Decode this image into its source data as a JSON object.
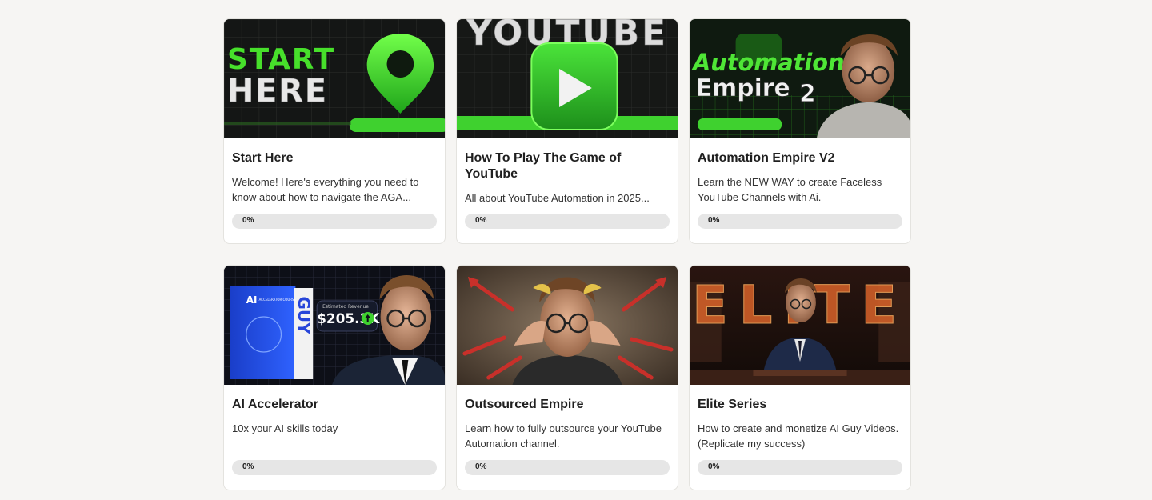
{
  "courses": [
    {
      "title": "Start Here",
      "description": "Welcome! Here's everything you need to know about how to navigate the AGA...",
      "progress_label": "0%",
      "progress": 0,
      "thumb": {
        "line1": "START",
        "line2": "HERE",
        "icon": "map-pin-icon"
      }
    },
    {
      "title": "How To Play The Game of YouTube",
      "description": "All about YouTube Automation in 2025...",
      "progress_label": "0%",
      "progress": 0,
      "thumb": {
        "text": "YOUTUBE",
        "icon": "play-button-icon"
      }
    },
    {
      "title": "Automation Empire V2",
      "description": "Learn the NEW WAY to create Faceless YouTube Channels with Ai.",
      "progress_label": "0%",
      "progress": 0,
      "thumb": {
        "line1": "Automation",
        "line2": "Empire",
        "badge": "2"
      }
    },
    {
      "title": "AI Accelerator",
      "description": "10x your AI skills today",
      "progress_label": "0%",
      "progress": 0,
      "thumb": {
        "box_label": "AI",
        "box_sublabel": "ACCELERATOR COURSE",
        "vertical": "GUY",
        "revenue_label": "Estimated Revenue",
        "revenue_value": "$205.3K"
      }
    },
    {
      "title": "Outsourced Empire",
      "description": "Learn how to fully outsource your YouTube Automation channel.",
      "progress_label": "0%",
      "progress": 0,
      "thumb": {}
    },
    {
      "title": "Elite Series",
      "description": "How to create and monetize AI Guy Videos. (Replicate my success)",
      "progress_label": "0%",
      "progress": 0,
      "thumb": {
        "text": "ELITE"
      }
    }
  ],
  "colors": {
    "accent_green": "#3fd12f",
    "page_bg": "#f6f5f3",
    "progress_track": "#e6e6e6"
  }
}
